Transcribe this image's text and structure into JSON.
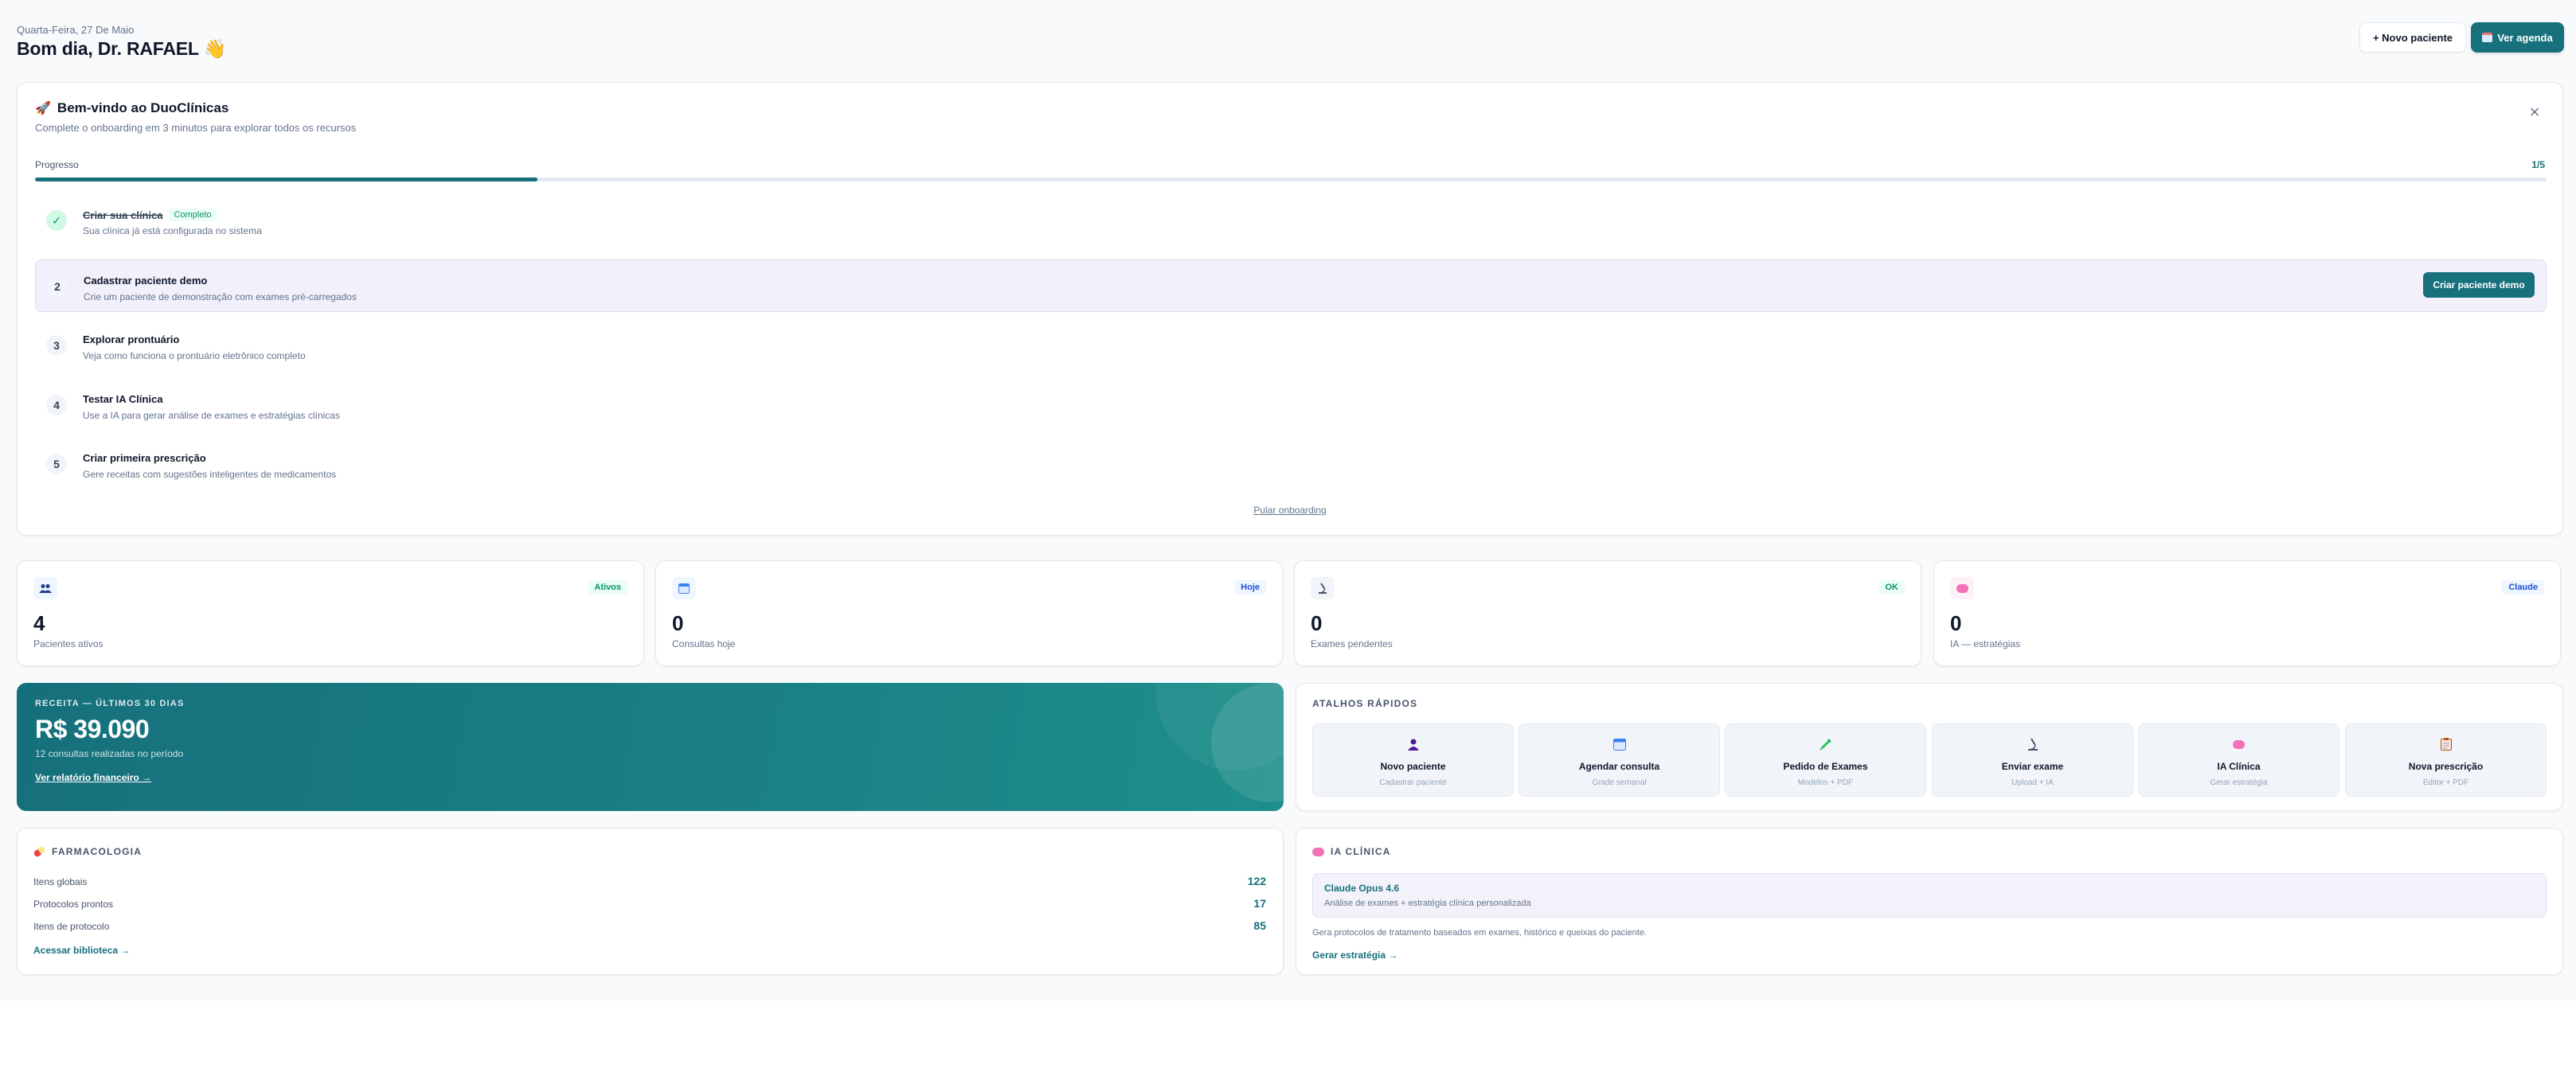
{
  "header": {
    "date": "Quarta-Feira, 27 De Maio",
    "greeting": "Bom dia, Dr. RAFAEL 👋",
    "new_patient_label": "+ Novo paciente",
    "agenda_label": "Ver agenda"
  },
  "onboarding": {
    "title": "Bem-vindo ao DuoClínicas",
    "subtitle": "Complete o onboarding em 3 minutos para explorar todos os recursos",
    "progress_label": "Progresso",
    "progress_count": "1/5",
    "progress_fraction": 0.2,
    "steps": [
      {
        "num": "✓",
        "title": "Criar sua clínica",
        "badge": "Completo",
        "desc": "Sua clínica já está configurada no sistema"
      },
      {
        "num": "2",
        "title": "Cadastrar paciente demo",
        "desc": "Crie um paciente de demonstração com exames pré-carregados",
        "action": "Criar paciente demo"
      },
      {
        "num": "3",
        "title": "Explorar prontuário",
        "desc": "Veja como funciona o prontuário eletrônico completo"
      },
      {
        "num": "4",
        "title": "Testar IA Clínica",
        "desc": "Use a IA para gerar análise de exames e estratégias clínicas"
      },
      {
        "num": "5",
        "title": "Criar primeira prescrição",
        "desc": "Gere receitas com sugestões inteligentes de medicamentos"
      }
    ],
    "skip_label": "Pular onboarding"
  },
  "stats": [
    {
      "value": "4",
      "label": "Pacientes ativos",
      "badge": "Ativos",
      "icon": "users-icon"
    },
    {
      "value": "0",
      "label": "Consultas hoje",
      "badge": "Hoje",
      "icon": "calendar-icon"
    },
    {
      "value": "0",
      "label": "Exames pendentes",
      "badge": "OK",
      "icon": "microscope-icon"
    },
    {
      "value": "0",
      "label": "IA — estratégias",
      "badge": "Claude",
      "icon": "brain-icon"
    }
  ],
  "revenue": {
    "label": "RECEITA — ÚLTIMOS 30 DIAS",
    "value": "R$ 39.090",
    "sub": "12 consultas realizadas no período",
    "link": "Ver relatório financeiro →"
  },
  "shortcuts": {
    "title": "ATALHOS RÁPIDOS",
    "items": [
      {
        "title": "Novo paciente",
        "sub": "Cadastrar paciente",
        "icon": "user-icon"
      },
      {
        "title": "Agendar consulta",
        "sub": "Grade semanal",
        "icon": "calendar-icon"
      },
      {
        "title": "Pedido de Exames",
        "sub": "Modelos + PDF",
        "icon": "syringe-icon"
      },
      {
        "title": "Enviar exame",
        "sub": "Upload + IA",
        "icon": "microscope-icon"
      },
      {
        "title": "IA Clínica",
        "sub": "Gerar estratégia",
        "icon": "brain-icon"
      },
      {
        "title": "Nova prescrição",
        "sub": "Editor + PDF",
        "icon": "clipboard-icon"
      }
    ]
  },
  "pharmacology": {
    "title": "FARMACOLOGIA",
    "rows": [
      {
        "label": "Itens globais",
        "value": "122"
      },
      {
        "label": "Protocolos prontos",
        "value": "17"
      },
      {
        "label": "Itens de protocolo",
        "value": "85"
      }
    ],
    "link": "Acessar biblioteca →"
  },
  "ia_clinica": {
    "title": "IA CLÍNICA",
    "model_title": "Claude Opus 4.6",
    "model_sub": "Análise de exames + estratégia clínica personalizada",
    "desc": "Gera protocolos de tratamento baseados em exames, histórico e queixas do paciente.",
    "link": "Gerar estratégia →"
  },
  "colors": {
    "accent": "#17707b",
    "badge_green": "#059669",
    "badge_blue": "#3b82f6"
  }
}
